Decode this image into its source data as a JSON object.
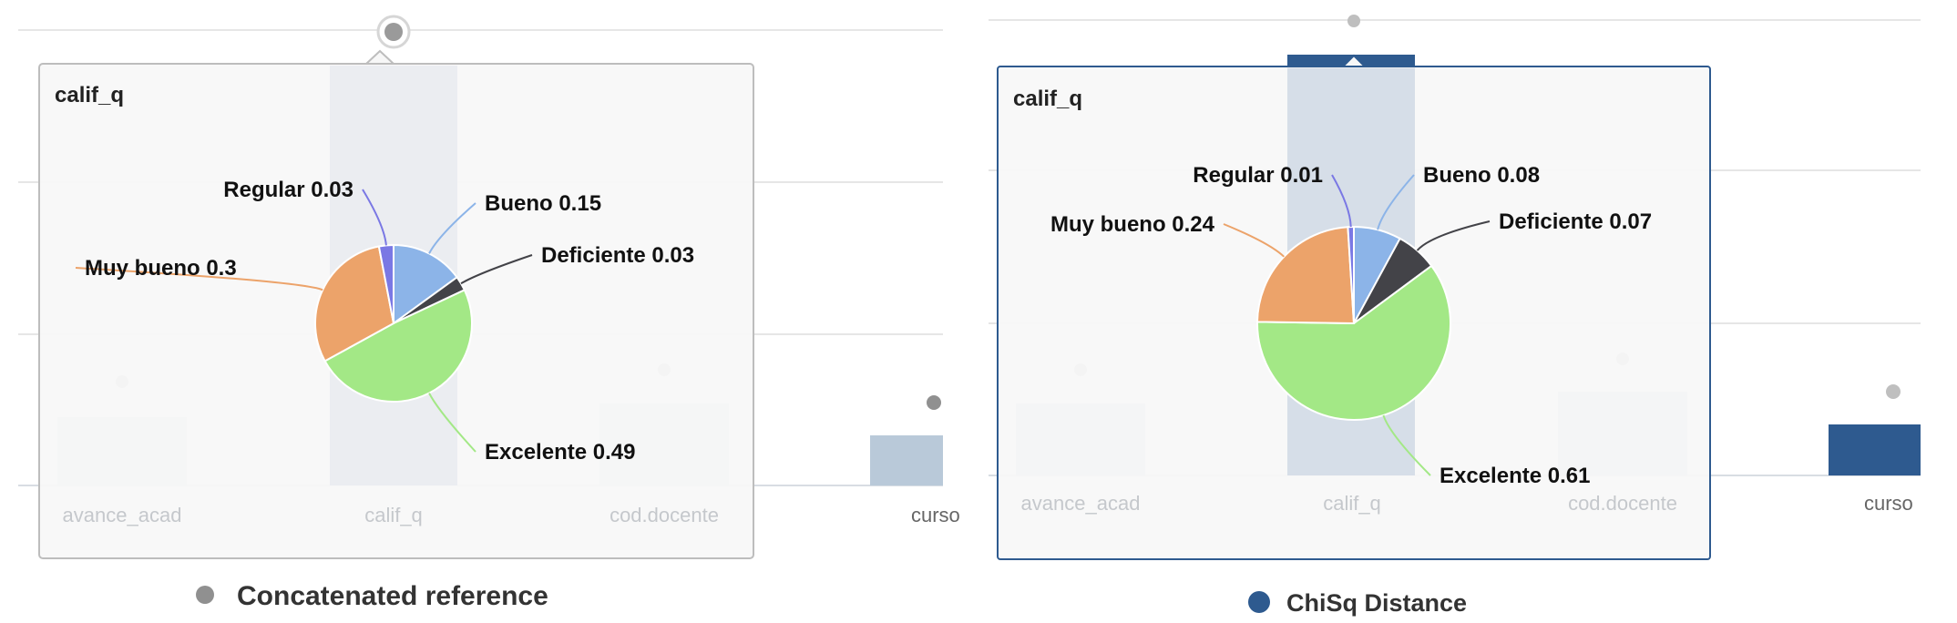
{
  "chart_data": [
    {
      "type": "pie",
      "tooltip_title": "calif_q",
      "categories": [
        "avance_acad",
        "calif_q",
        "cod.docente",
        "curso"
      ],
      "legend": {
        "label": "Concatenated reference",
        "color": "#909090",
        "placement": "bottom"
      },
      "slices": [
        {
          "name": "Bueno",
          "value": 0.15,
          "label": "Bueno 0.15",
          "color": "#8cb4e8"
        },
        {
          "name": "Deficiente",
          "value": 0.03,
          "label": "Deficiente 0.03",
          "color": "#434348"
        },
        {
          "name": "Excelente",
          "value": 0.49,
          "label": "Excelente 0.49",
          "color": "#a3e886"
        },
        {
          "name": "Muy bueno",
          "value": 0.3,
          "label": "Muy bueno 0.3",
          "color": "#eca36a"
        },
        {
          "name": "Regular",
          "value": 0.03,
          "label": "Regular 0.03",
          "color": "#7a78e4"
        }
      ]
    },
    {
      "type": "pie",
      "tooltip_title": "calif_q",
      "categories": [
        "avance_acad",
        "calif_q",
        "cod.docente",
        "curso"
      ],
      "legend": {
        "label": "ChiSq Distance",
        "color": "#2e5a8f",
        "placement": "bottom"
      },
      "slices": [
        {
          "name": "Bueno",
          "value": 0.08,
          "label": "Bueno 0.08",
          "color": "#8cb4e8"
        },
        {
          "name": "Deficiente",
          "value": 0.07,
          "label": "Deficiente 0.07",
          "color": "#434348"
        },
        {
          "name": "Excelente",
          "value": 0.61,
          "label": "Excelente 0.61",
          "color": "#a3e886"
        },
        {
          "name": "Muy bueno",
          "value": 0.24,
          "label": "Muy bueno 0.24",
          "color": "#eca36a"
        },
        {
          "name": "Regular",
          "value": 0.01,
          "label": "Regular 0.01",
          "color": "#7a78e4"
        }
      ]
    }
  ]
}
